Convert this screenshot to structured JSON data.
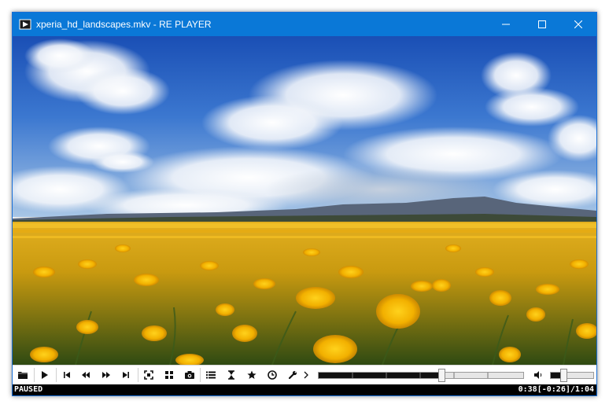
{
  "window": {
    "title": "xperia_hd_landscapes.mkv - RE PLAYER",
    "titlebar_color": "#0A78D7"
  },
  "window_controls": [
    {
      "icon": "minimize-icon"
    },
    {
      "icon": "maximize-icon"
    },
    {
      "icon": "close-icon"
    }
  ],
  "toolbar": {
    "buttons": [
      {
        "icon": "open-folder-icon"
      },
      {
        "icon": "play-icon"
      },
      {
        "icon": "skip-previous-icon"
      },
      {
        "icon": "rewind-icon"
      },
      {
        "icon": "fast-forward-icon"
      },
      {
        "icon": "skip-next-icon"
      },
      {
        "icon": "fullscreen-icon"
      },
      {
        "icon": "grid-icon"
      },
      {
        "icon": "camera-icon"
      },
      {
        "icon": "playlist-icon"
      },
      {
        "icon": "hourglass-icon"
      },
      {
        "icon": "star-icon"
      },
      {
        "icon": "clock-icon"
      },
      {
        "icon": "wrench-icon"
      },
      {
        "icon": "chevron-right-icon"
      }
    ]
  },
  "seek": {
    "progress": 0.6
  },
  "volume": {
    "icon": "speaker-icon",
    "level": 0.3
  },
  "status": {
    "state": "PAUSED",
    "elapsed": "0:38",
    "remaining": "[-0:26]",
    "separator": "/",
    "duration": "1:04"
  }
}
